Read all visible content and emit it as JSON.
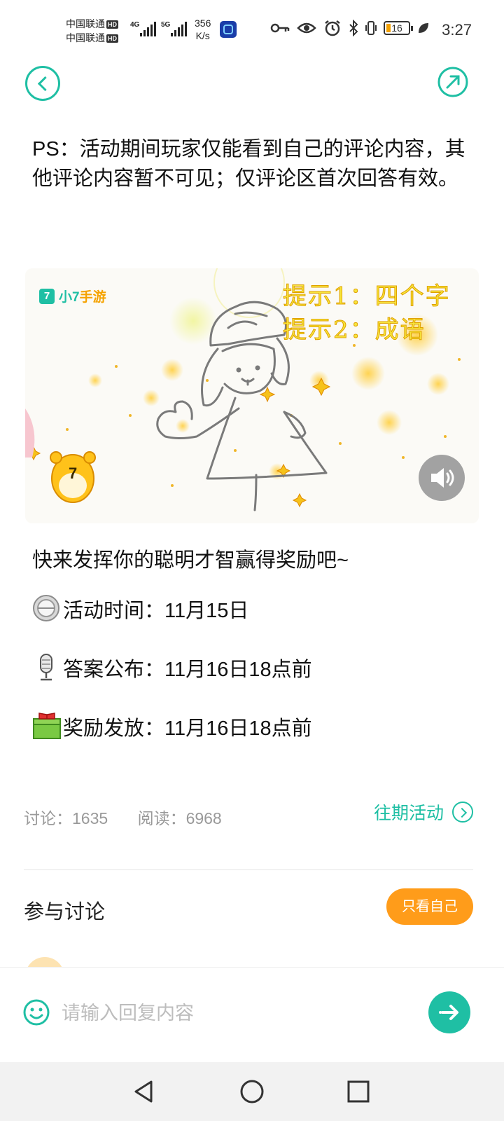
{
  "status_bar": {
    "carrier1": "中国联通",
    "carrier2": "中国联通",
    "hd": "HD",
    "net1": "4G",
    "net2": "5G",
    "speed_value": "356",
    "speed_unit": "K/s",
    "battery": "16",
    "time": "3:27"
  },
  "nav": {
    "back_icon": "chevron-left-circle-icon",
    "share_icon": "share-arrow-icon"
  },
  "post": {
    "ps_text": "PS：活动期间玩家仅能看到自己的评论内容，其他评论内容暂不可见；仅评论区首次回答有效。",
    "media": {
      "logo_num": "7",
      "logo_text_green": "小7",
      "logo_text_orange": "手游",
      "hint1": "提示1：四个字",
      "hint2": "提示2：成语"
    },
    "invite": "快来发挥你的聪明才智赢得奖励吧~",
    "info": [
      {
        "label": "活动时间：11月15日",
        "icon": "clock-icon"
      },
      {
        "label": "答案公布：11月16日18点前",
        "icon": "microphone-icon"
      },
      {
        "label": "奖励发放：11月16日18点前",
        "icon": "gift-icon"
      }
    ]
  },
  "stats": {
    "discuss": "讨论：1635",
    "read": "阅读：6968",
    "past_link": "往期活动"
  },
  "discussion": {
    "title": "参与讨论",
    "only_me": "只看自己"
  },
  "reply": {
    "placeholder": "请输入回复内容"
  },
  "colors": {
    "accent": "#1fbfa4",
    "orange": "#ff9c1a",
    "muted": "#999999"
  }
}
